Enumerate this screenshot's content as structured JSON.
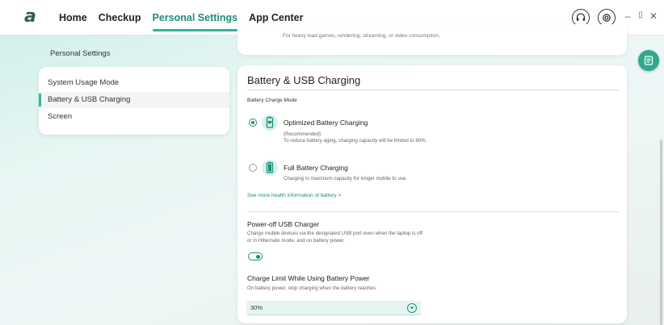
{
  "nav": {
    "logo": "a",
    "items": [
      {
        "label": "Home",
        "active": false
      },
      {
        "label": "Checkup",
        "active": false
      },
      {
        "label": "Personal Settings",
        "active": true
      },
      {
        "label": "App Center",
        "active": false
      }
    ]
  },
  "top_icons": {
    "support": "headset-icon",
    "settings": "gear-icon",
    "minimize": "–",
    "restore": "▯",
    "close": "✕"
  },
  "sidebar": {
    "title": "Personal Settings",
    "items": [
      {
        "label": "System Usage Mode",
        "active": false
      },
      {
        "label": "Battery & USB Charging",
        "active": true
      },
      {
        "label": "Screen",
        "active": false
      }
    ]
  },
  "top_card": {
    "text": "For heavy load games, rendering, streaming, or video consumption."
  },
  "main": {
    "title": "Battery & USB Charging",
    "charge_mode_label": "Battery Charge Mode",
    "options": [
      {
        "title": "Optimized Battery Charging",
        "desc1": "(Recommended)",
        "desc2": "To reduce battery aging, charging capacity will be limited to 80%.",
        "selected": true,
        "icon": "heart-battery-icon"
      },
      {
        "title": "Full Battery Charging",
        "desc1": "Charging to maximum capacity for longer mobile to use.",
        "selected": false,
        "icon": "battery-full-icon"
      }
    ],
    "health_link": "See more health information of battery >",
    "usb": {
      "title": "Power-off USB Charger",
      "desc1": "Charge mobile devices via the designated USB port even when the laptop is off",
      "desc2": "or in Hibernate mode, and on battery power.",
      "enabled": true
    },
    "charge_limit": {
      "title": "Charge Limit While Using Battery Power",
      "desc": "On battery power, stop charging when the battery reaches:",
      "value": "30%"
    }
  },
  "colors": {
    "accent": "#2db49a",
    "accent_dark": "#1c8f78"
  }
}
